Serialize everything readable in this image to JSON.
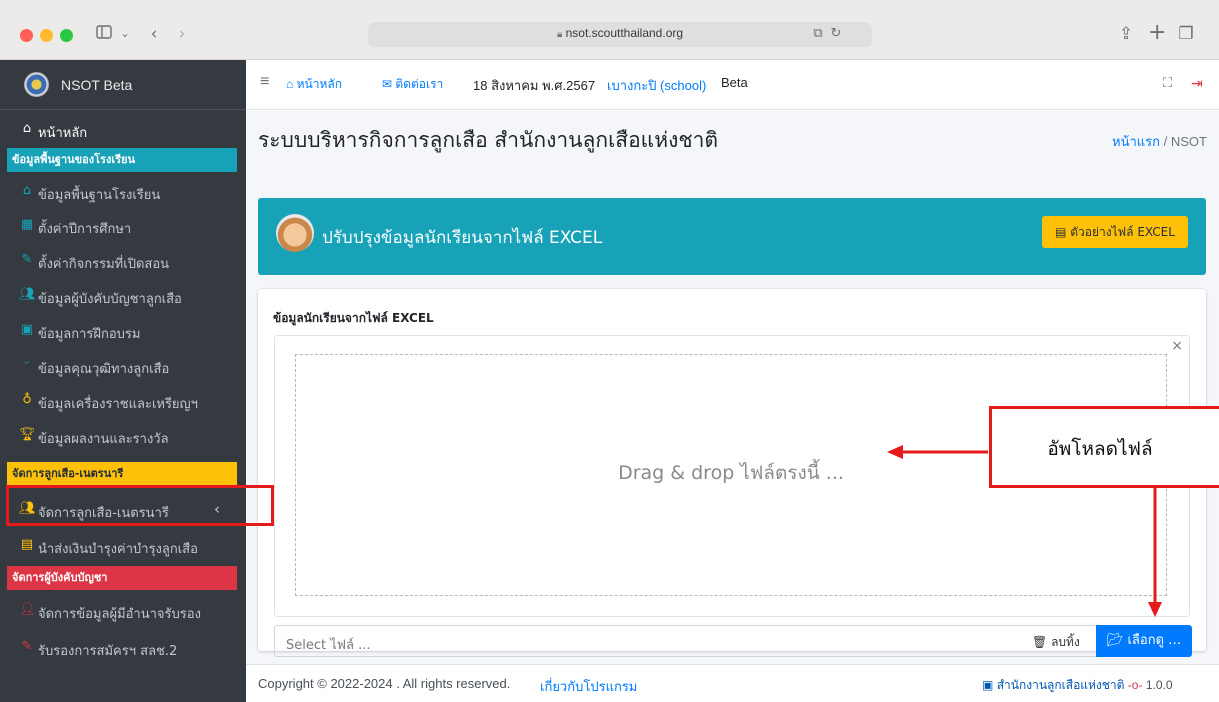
{
  "browser": {
    "url": "nsot.scoutthailand.org",
    "colors": {
      "close": "#fe5f57",
      "minimize": "#febc2e",
      "maximize": "#28c840"
    }
  },
  "sidebar": {
    "brand": "NSOT Beta",
    "home": "หน้าหลัก",
    "sections": [
      {
        "header": "ข้อมูลพื้นฐานของโรงเรียน",
        "color": "#17a2b8"
      },
      {
        "header": "จัดการลูกเสือ-เนตรนารี",
        "color": "#ffc107"
      },
      {
        "header": "จัดการผู้บังคับบัญชา",
        "color": "#dc3545"
      }
    ],
    "items": [
      {
        "label": "ข้อมูลพื้นฐานโรงเรียน",
        "icon": "school-icon",
        "color": "#17a2b8"
      },
      {
        "label": "ตั้งค่าปีการศึกษา",
        "icon": "calendar-icon",
        "color": "#17a2b8"
      },
      {
        "label": "ตั้งค่ากิจกรรมที่เปิดสอน",
        "icon": "edit-icon",
        "color": "#17a2b8"
      },
      {
        "label": "ข้อมูลผู้บังคับบัญชาลูกเสือ",
        "icon": "users-icon",
        "color": "#17a2b8"
      },
      {
        "label": "ข้อมูลการฝึกอบรม",
        "icon": "id-card-icon",
        "color": "#17a2b8"
      },
      {
        "label": "ข้อมูลคุณวุฒิทางลูกเสือ",
        "icon": "ribbon-icon",
        "color": "#17a2b8"
      },
      {
        "label": "ข้อมูลเครื่องราชและเหรียญฯ",
        "icon": "medal-icon",
        "color": "#ffc107"
      },
      {
        "label": "ข้อมูลผลงานและรางวัล",
        "icon": "trophy-icon",
        "color": "#ffc107"
      },
      {
        "label": "จัดการลูกเสือ-เนตรนารี",
        "icon": "users-icon",
        "color": "#ffc107"
      },
      {
        "label": "นำส่งเงินบำรุงค่าบำรุงลูกเสือ",
        "icon": "money-icon",
        "color": "#ffc107"
      },
      {
        "label": "จัดการข้อมูลผู้มีอำนาจรับรอง",
        "icon": "user-edit-icon",
        "color": "#dc3545"
      },
      {
        "label": "รับรองการสมัครฯ สลช.2",
        "icon": "edit-icon",
        "color": "#dc3545"
      }
    ]
  },
  "topbar": {
    "home": "หน้าหลัก",
    "contact": "ติดต่อเรา",
    "date": "18 สิงหาคม พ.ศ.2567",
    "school": "เบางกะปิ (school)",
    "suffix": "Beta"
  },
  "page": {
    "title": "ระบบบริหารกิจการลูกเสือ สำนักงานลูกเสือแห่งชาติ",
    "breadcrumb_home": "หน้าแรก",
    "breadcrumb_sep": "/",
    "breadcrumb_current": "NSOT"
  },
  "banner": {
    "title": "ปรับปรุงข้อมูลนักเรียนจากไฟล์ EXCEL",
    "button": "ตัวอย่างไฟล์ EXCEL"
  },
  "upload": {
    "label": "ข้อมูลนักเรียนจากไฟล์ EXCEL",
    "drop_text": "Drag & drop ไฟล์ตรงนี้ ...",
    "close": "×",
    "placeholder": "Select ไฟล์ ...",
    "remove": "ลบทิ้ง",
    "browse": "เลือกดู …"
  },
  "footer": {
    "copyright": "Copyright © 2022-2024 . All rights reserved.",
    "about": "เกี่ยวกับโปรแกรม",
    "org": "สำนักงานลูกเสือแห่งชาติ",
    "version": "1.0.0"
  },
  "annotation": {
    "callout": "อัพโหลดไฟล์",
    "color": "#e51a1a"
  }
}
